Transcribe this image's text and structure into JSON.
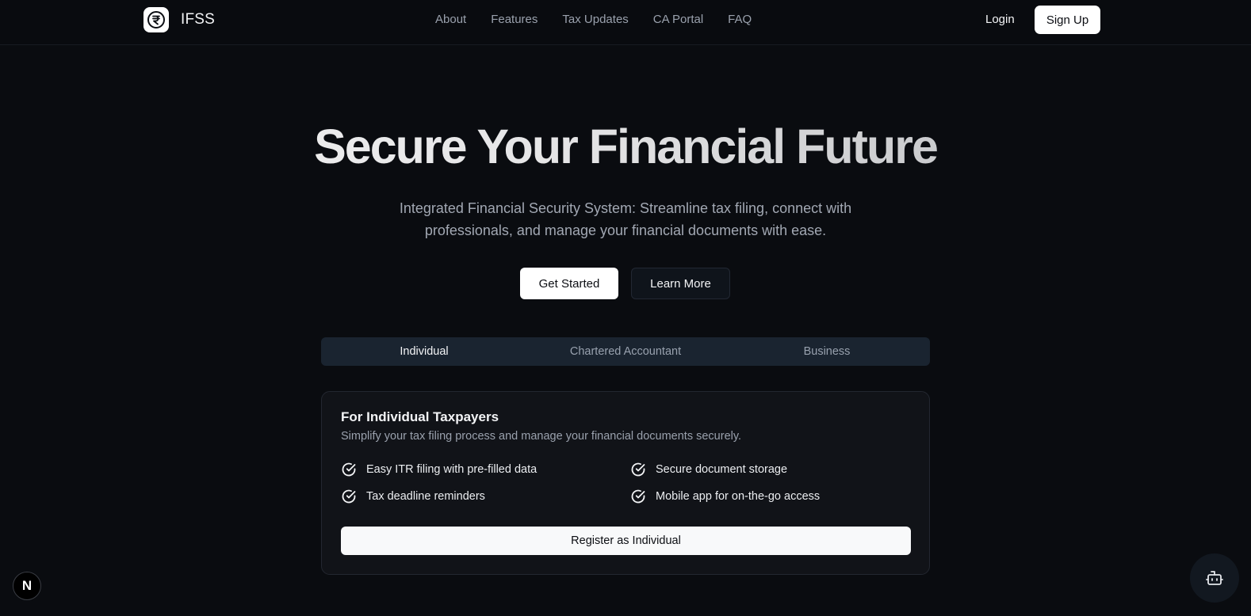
{
  "brand": {
    "name": "IFSS",
    "logo_icon": "rupee-icon"
  },
  "nav": {
    "items": [
      "About",
      "Features",
      "Tax Updates",
      "CA Portal",
      "FAQ"
    ]
  },
  "auth": {
    "login_label": "Login",
    "signup_label": "Sign Up"
  },
  "hero": {
    "title": "Secure Your Financial Future",
    "subtitle": "Integrated Financial Security System: Streamline tax filing, connect with professionals, and manage your financial documents with ease.",
    "primary_label": "Get Started",
    "secondary_label": "Learn More"
  },
  "tabs": {
    "items": [
      "Individual",
      "Chartered Accountant",
      "Business"
    ],
    "active": "Individual"
  },
  "card": {
    "title": "For Individual Taxpayers",
    "description": "Simplify your tax filing process and manage your financial documents securely.",
    "features": [
      "Easy ITR filing with pre-filled data",
      "Secure document storage",
      "Tax deadline reminders",
      "Mobile app for on-the-go access"
    ],
    "register_label": "Register as Individual"
  },
  "floating": {
    "badge_letter": "N",
    "assistant_icon": "bot-icon"
  },
  "colors": {
    "background": "#0a0c10",
    "tab_bar": "#1a2430",
    "card": "#111318",
    "button_light": "#ffffff"
  }
}
